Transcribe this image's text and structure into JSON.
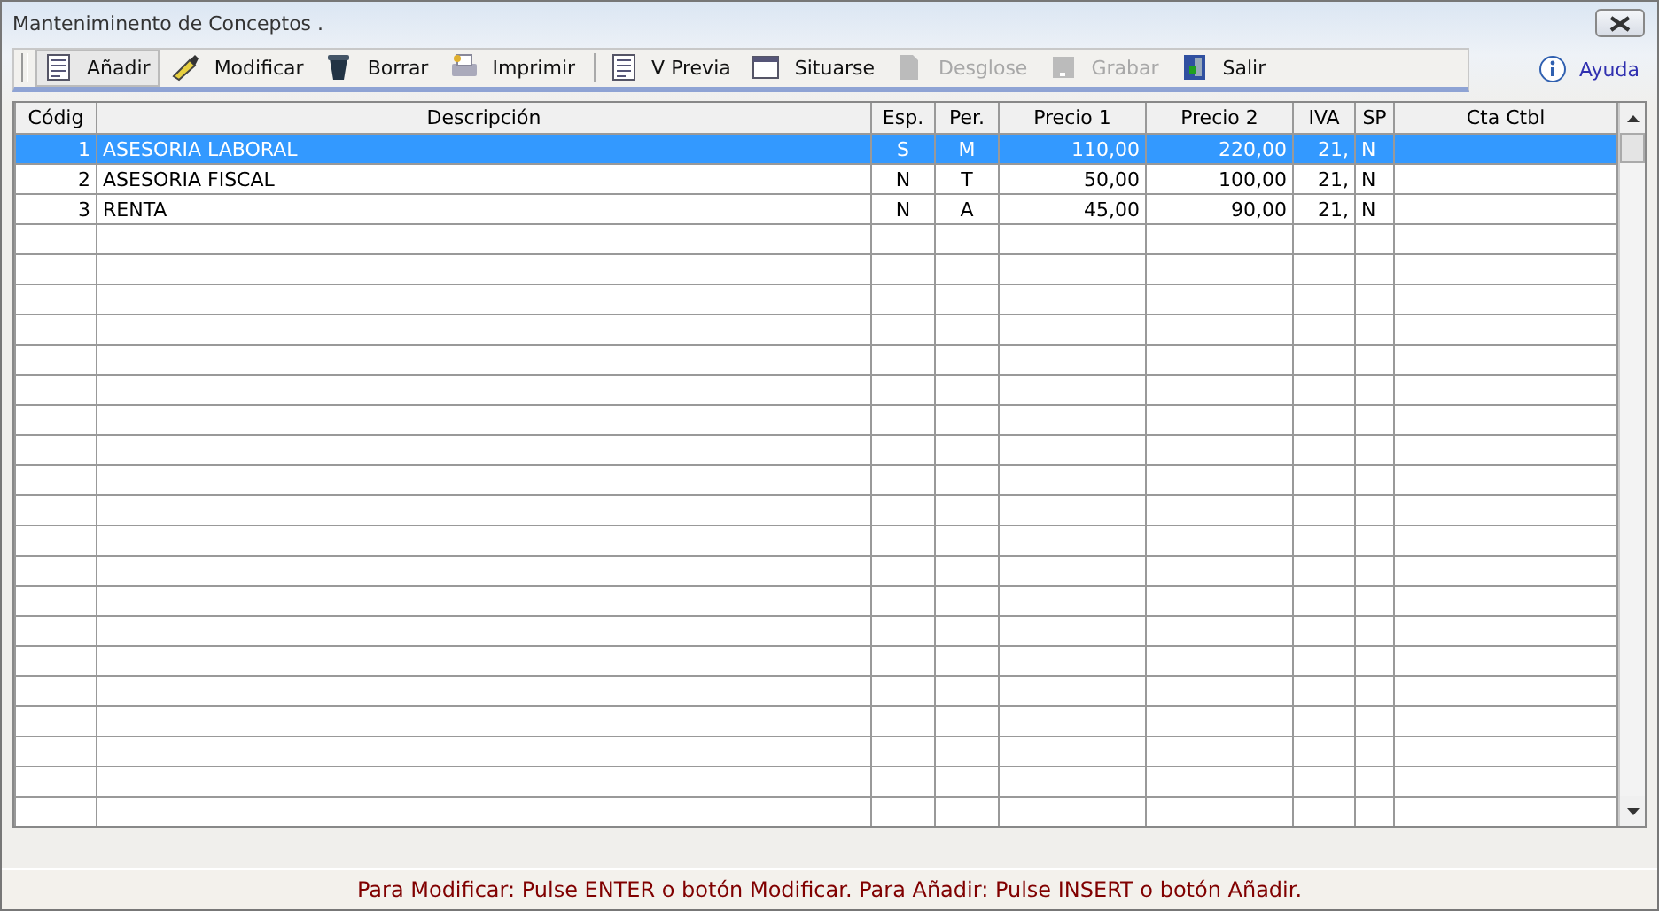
{
  "window": {
    "title": "Manteniminento de Conceptos ."
  },
  "toolbar": [
    {
      "label": "Añadir",
      "disabled": false,
      "selected": true,
      "separator_before": false
    },
    {
      "label": "Modificar",
      "disabled": false,
      "selected": false,
      "separator_before": false
    },
    {
      "label": "Borrar",
      "disabled": false,
      "selected": false,
      "separator_before": false
    },
    {
      "label": "Imprimir",
      "disabled": false,
      "selected": false,
      "separator_before": false
    },
    {
      "label": "V Previa",
      "disabled": false,
      "selected": false,
      "separator_before": true
    },
    {
      "label": "Situarse",
      "disabled": false,
      "selected": false,
      "separator_before": false
    },
    {
      "label": "Desglose",
      "disabled": true,
      "selected": false,
      "separator_before": false
    },
    {
      "label": "Grabar",
      "disabled": true,
      "selected": false,
      "separator_before": false
    },
    {
      "label": "Salir",
      "disabled": false,
      "selected": false,
      "separator_before": false
    }
  ],
  "help": {
    "label": "Ayuda"
  },
  "table": {
    "columns": [
      "Códig",
      "Descripción",
      "Esp.",
      "Per.",
      "Precio 1",
      "Precio 2",
      "IVA",
      "SP",
      "Cta Ctbl"
    ],
    "rows": [
      {
        "selected": true,
        "cells": [
          "1",
          "ASESORIA LABORAL",
          "S",
          "M",
          "110,00",
          "220,00",
          "21,",
          "N"
        ]
      },
      {
        "selected": false,
        "cells": [
          "2",
          "ASESORIA FISCAL",
          "N",
          "T",
          "50,00",
          "100,00",
          "21,",
          "N"
        ]
      },
      {
        "selected": false,
        "cells": [
          "3",
          "RENTA",
          "N",
          "A",
          "45,00",
          "90,00",
          "21,",
          "N"
        ]
      }
    ]
  },
  "status_bar": "Para Modificar: Pulse ENTER o botón Modificar. Para Añadir: Pulse INSERT o botón Añadir."
}
